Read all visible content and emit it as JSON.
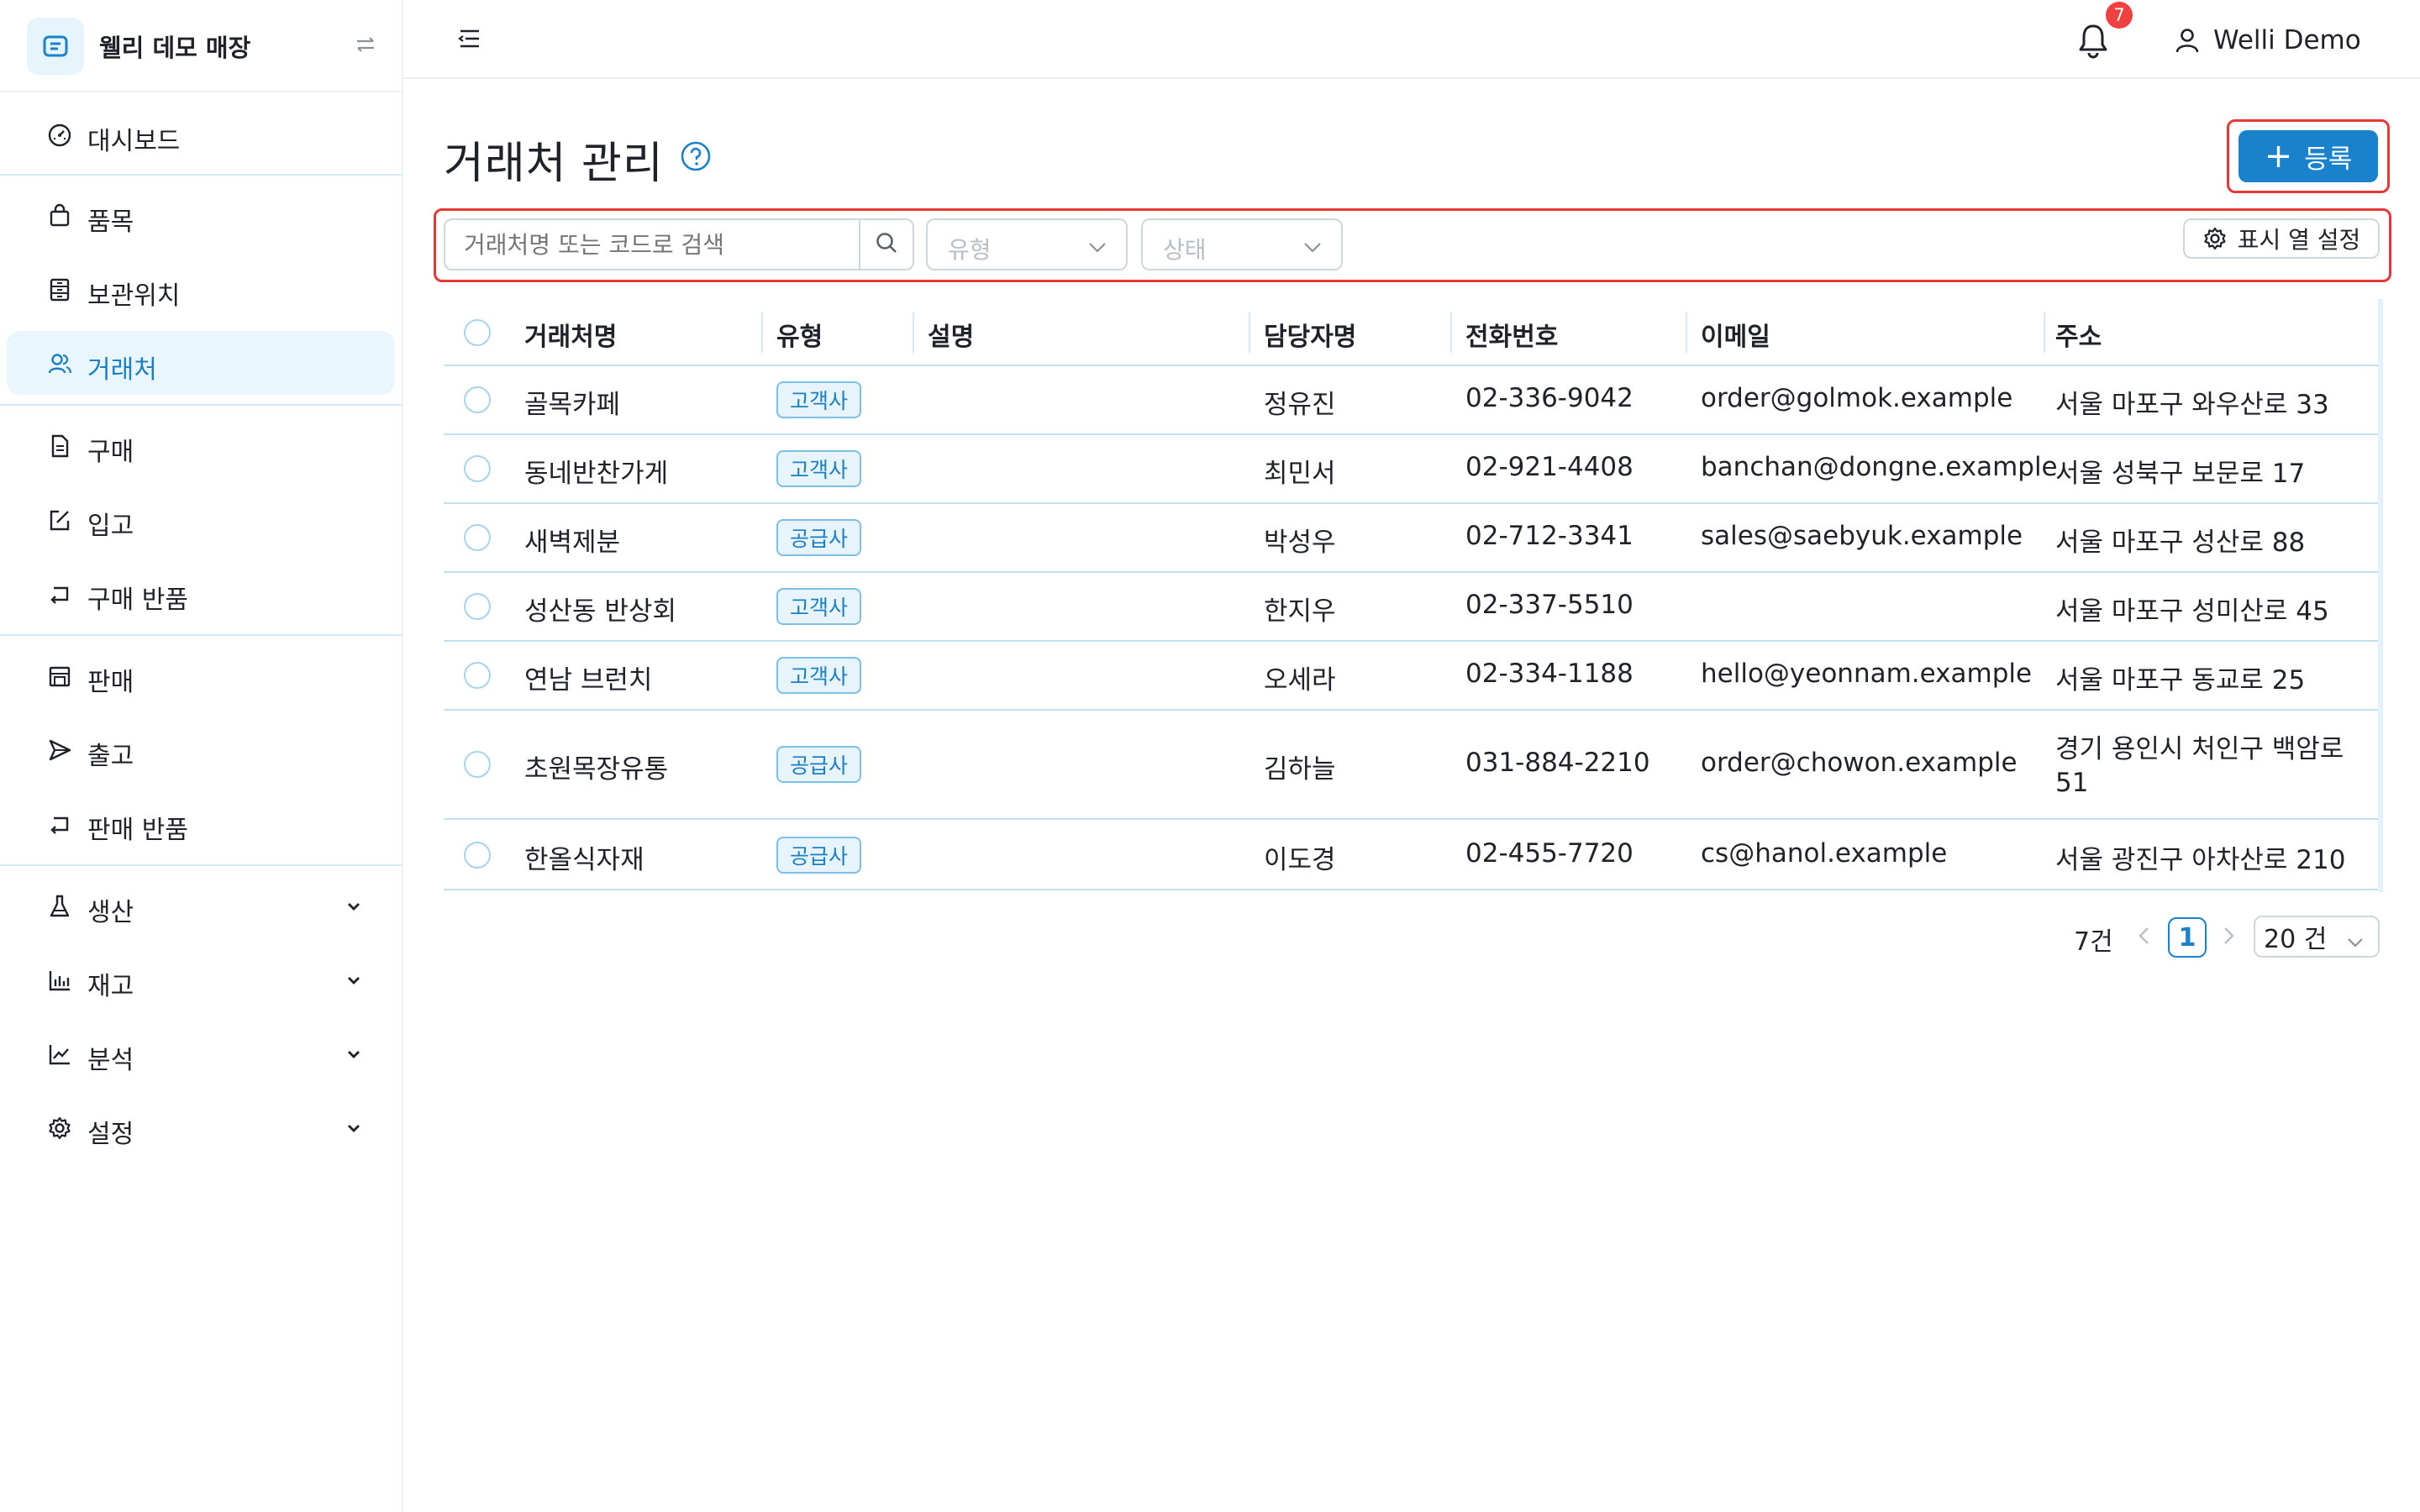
{
  "brand": {
    "name": "웰리 데모 매장"
  },
  "sidebar": {
    "items": [
      {
        "label": "대시보드",
        "icon": "dashboard-gauge-icon"
      },
      {
        "label": "품목",
        "icon": "shopping-bag-icon"
      },
      {
        "label": "보관위치",
        "icon": "storage-cabinet-icon"
      },
      {
        "label": "거래처",
        "icon": "partners-users-icon",
        "active": true
      },
      {
        "label": "구매",
        "icon": "document-icon"
      },
      {
        "label": "입고",
        "icon": "edit-box-icon"
      },
      {
        "label": "구매 반품",
        "icon": "return-arrow-icon"
      },
      {
        "label": "판매",
        "icon": "shop-icon"
      },
      {
        "label": "출고",
        "icon": "send-icon"
      },
      {
        "label": "판매 반품",
        "icon": "return-arrow-icon"
      },
      {
        "label": "생산",
        "icon": "flask-icon",
        "expandable": true
      },
      {
        "label": "재고",
        "icon": "bar-chart-icon",
        "expandable": true
      },
      {
        "label": "분석",
        "icon": "line-chart-icon",
        "expandable": true
      },
      {
        "label": "설정",
        "icon": "gear-icon",
        "expandable": true
      }
    ]
  },
  "header": {
    "notification_count": "7",
    "user_name": "Welli Demo"
  },
  "page": {
    "title": "거래처 관리",
    "register_label": "등록",
    "search_placeholder": "거래처명 또는 코드로 검색",
    "type_placeholder": "유형",
    "status_placeholder": "상태",
    "columns_label": "표시 열 설정"
  },
  "table": {
    "headers": {
      "name": "거래처명",
      "type": "유형",
      "description": "설명",
      "contact": "담당자명",
      "phone": "전화번호",
      "email": "이메일",
      "address": "주소"
    },
    "rows": [
      {
        "name": "골목카페",
        "type": "고객사",
        "description": "",
        "contact": "정유진",
        "phone": "02-336-9042",
        "email": "order@golmok.example",
        "address": "서울 마포구 와우산로 33"
      },
      {
        "name": "동네반찬가게",
        "type": "고객사",
        "description": "",
        "contact": "최민서",
        "phone": "02-921-4408",
        "email": "banchan@dongne.example",
        "address": "서울 성북구 보문로 17"
      },
      {
        "name": "새벽제분",
        "type": "공급사",
        "description": "",
        "contact": "박성우",
        "phone": "02-712-3341",
        "email": "sales@saebyuk.example",
        "address": "서울 마포구 성산로 88"
      },
      {
        "name": "성산동 반상회",
        "type": "고객사",
        "description": "",
        "contact": "한지우",
        "phone": "02-337-5510",
        "email": "",
        "address": "서울 마포구 성미산로 45"
      },
      {
        "name": "연남 브런치",
        "type": "고객사",
        "description": "",
        "contact": "오세라",
        "phone": "02-334-1188",
        "email": "hello@yeonnam.example",
        "address": "서울 마포구 동교로 25"
      },
      {
        "name": "초원목장유통",
        "type": "공급사",
        "description": "",
        "contact": "김하늘",
        "phone": "031-884-2210",
        "email": "order@chowon.example",
        "address_line1": "경기 용인시 처인구 백암로",
        "address_line2": "51"
      },
      {
        "name": "한올식자재",
        "type": "공급사",
        "description": "",
        "contact": "이도경",
        "phone": "02-455-7720",
        "email": "cs@hanol.example",
        "address": "서울 광진구 아차산로 210"
      }
    ]
  },
  "pagination": {
    "total": "7건",
    "current_page": "1",
    "page_size": "20 건"
  },
  "colors": {
    "accent": "#1a82cc",
    "active_bg": "#eaf6fd",
    "badge": "#f04040",
    "highlight": "#e53935"
  }
}
